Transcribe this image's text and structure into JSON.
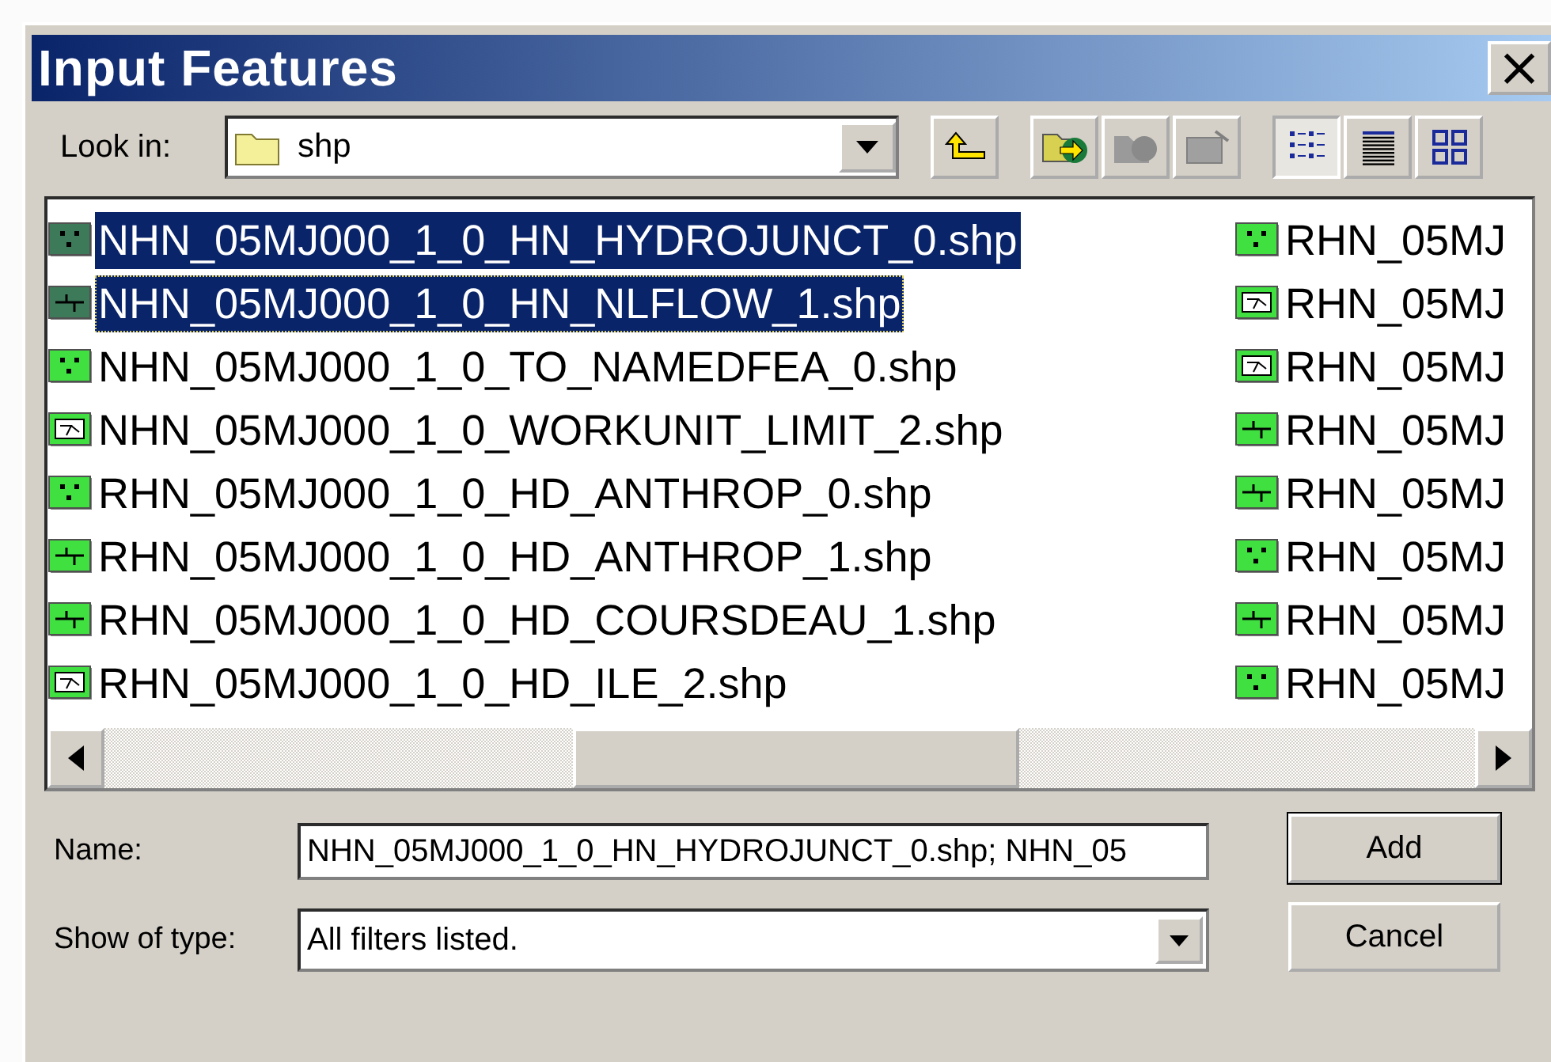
{
  "window": {
    "title": "Input Features",
    "close": "×"
  },
  "look_in": {
    "label": "Look in:",
    "value": "shp"
  },
  "toolbar": [
    {
      "kind": "up",
      "disabled": false,
      "pressed": false
    },
    {
      "kind": "connect",
      "disabled": false,
      "pressed": false
    },
    {
      "kind": "disconnect",
      "disabled": true,
      "pressed": false
    },
    {
      "kind": "properties",
      "disabled": true,
      "pressed": false
    },
    {
      "kind": "list",
      "disabled": false,
      "pressed": true
    },
    {
      "kind": "details",
      "disabled": false,
      "pressed": false
    },
    {
      "kind": "thumbnails",
      "disabled": false,
      "pressed": false
    }
  ],
  "files": [
    {
      "name": "NHN_05MJ000_1_0_HN_HYDROJUNCT_0.shp",
      "kind": "point",
      "selected": true,
      "focused": false
    },
    {
      "name": "NHN_05MJ000_1_0_HN_NLFLOW_1.shp",
      "kind": "line",
      "selected": true,
      "focused": true
    },
    {
      "name": "NHN_05MJ000_1_0_TO_NAMEDFEA_0.shp",
      "kind": "point",
      "selected": false,
      "focused": false
    },
    {
      "name": "NHN_05MJ000_1_0_WORKUNIT_LIMIT_2.shp",
      "kind": "polygon",
      "selected": false,
      "focused": false
    },
    {
      "name": "RHN_05MJ000_1_0_HD_ANTHROP_0.shp",
      "kind": "point",
      "selected": false,
      "focused": false
    },
    {
      "name": "RHN_05MJ000_1_0_HD_ANTHROP_1.shp",
      "kind": "line",
      "selected": false,
      "focused": false
    },
    {
      "name": "RHN_05MJ000_1_0_HD_COURSDEAU_1.shp",
      "kind": "line",
      "selected": false,
      "focused": false
    },
    {
      "name": "RHN_05MJ000_1_0_HD_ILE_2.shp",
      "kind": "polygon",
      "selected": false,
      "focused": false
    },
    {
      "name": "RHN_05MJ",
      "kind": "point",
      "selected": false,
      "focused": false
    },
    {
      "name": "RHN_05MJ",
      "kind": "polygon",
      "selected": false,
      "focused": false
    },
    {
      "name": "RHN_05MJ",
      "kind": "polygon",
      "selected": false,
      "focused": false
    },
    {
      "name": "RHN_05MJ",
      "kind": "line",
      "selected": false,
      "focused": false
    },
    {
      "name": "RHN_05MJ",
      "kind": "line",
      "selected": false,
      "focused": false
    },
    {
      "name": "RHN_05MJ",
      "kind": "point",
      "selected": false,
      "focused": false
    },
    {
      "name": "RHN_05MJ",
      "kind": "line",
      "selected": false,
      "focused": false
    },
    {
      "name": "RHN_05MJ",
      "kind": "point",
      "selected": false,
      "focused": false
    }
  ],
  "name_field": {
    "label": "Name:",
    "value": "NHN_05MJ000_1_0_HN_HYDROJUNCT_0.shp; NHN_05"
  },
  "type_field": {
    "label": "Show of type:",
    "value": "All filters listed."
  },
  "buttons": [
    {
      "label": "Add",
      "default": true
    },
    {
      "label": "Cancel",
      "default": false
    }
  ]
}
